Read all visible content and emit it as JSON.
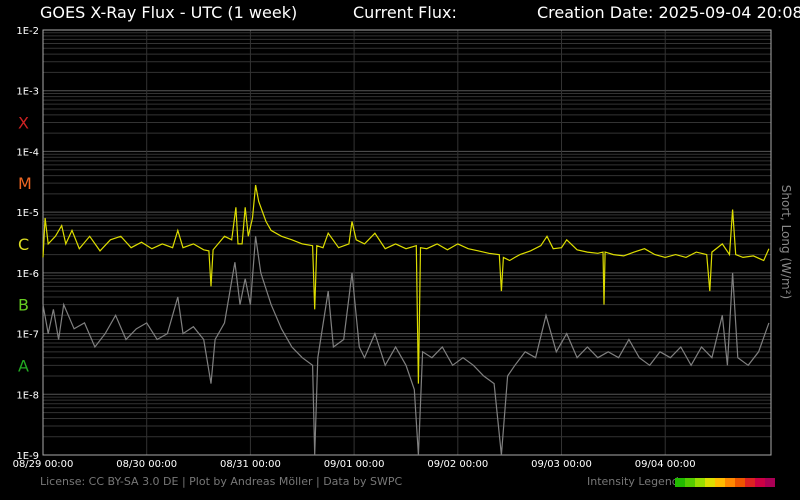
{
  "header": {
    "title": "GOES X-Ray Flux - UTC (1 week)",
    "current_flux_label": "Current Flux:",
    "creation_date": "Creation Date: 2025-09-04 20:08"
  },
  "footer": "License: CC BY-SA 3.0 DE | Plot by Andreas Möller | Data by SWPC",
  "legend": {
    "label": "Intensity Legend",
    "colors": [
      "#22bb00",
      "#55cc00",
      "#99dd00",
      "#dddd00",
      "#ffbb00",
      "#ff8800",
      "#ee5500",
      "#dd2222",
      "#cc0044",
      "#aa0055"
    ]
  },
  "chart_data": {
    "type": "line",
    "ylabel": "Short, Long (W/m²)",
    "y_scale": "log",
    "ylim": [
      1e-09,
      0.01
    ],
    "y_ticks": [
      "1E-9",
      "1E-8",
      "1E-7",
      "1E-6",
      "1E-5",
      "1E-4",
      "1E-3",
      "1E-2"
    ],
    "flare_classes": [
      {
        "label": "X",
        "at": 0.0003,
        "color": "#cc2222"
      },
      {
        "label": "M",
        "at": 3e-05,
        "color": "#ee6622"
      },
      {
        "label": "C",
        "at": 3e-06,
        "color": "#dddd22"
      },
      {
        "label": "B",
        "at": 3e-07,
        "color": "#66cc22"
      },
      {
        "label": "A",
        "at": 3e-08,
        "color": "#22aa22"
      }
    ],
    "x_ticks": [
      "08/29 00:00",
      "08/30 00:00",
      "08/31 00:00",
      "09/01 00:00",
      "09/02 00:00",
      "09/03 00:00",
      "09/04 00:00"
    ],
    "x_range_days": [
      0,
      7.02
    ],
    "grid": true,
    "series": [
      {
        "name": "Long",
        "color": "#dddd00",
        "points": [
          [
            0,
            1.8e-06
          ],
          [
            0.02,
            8e-06
          ],
          [
            0.05,
            3e-06
          ],
          [
            0.12,
            4e-06
          ],
          [
            0.18,
            6e-06
          ],
          [
            0.22,
            3e-06
          ],
          [
            0.28,
            5e-06
          ],
          [
            0.35,
            2.5e-06
          ],
          [
            0.45,
            4e-06
          ],
          [
            0.55,
            2.3e-06
          ],
          [
            0.65,
            3.5e-06
          ],
          [
            0.75,
            4e-06
          ],
          [
            0.85,
            2.6e-06
          ],
          [
            0.95,
            3.2e-06
          ],
          [
            1.05,
            2.5e-06
          ],
          [
            1.15,
            3e-06
          ],
          [
            1.25,
            2.6e-06
          ],
          [
            1.3,
            5e-06
          ],
          [
            1.35,
            2.6e-06
          ],
          [
            1.45,
            3e-06
          ],
          [
            1.55,
            2.4e-06
          ],
          [
            1.6,
            2.3e-06
          ],
          [
            1.62,
            6e-07
          ],
          [
            1.64,
            2.4e-06
          ],
          [
            1.75,
            4e-06
          ],
          [
            1.82,
            3.5e-06
          ],
          [
            1.86,
            1.2e-05
          ],
          [
            1.88,
            3e-06
          ],
          [
            1.92,
            3e-06
          ],
          [
            1.95,
            1.2e-05
          ],
          [
            1.98,
            4e-06
          ],
          [
            2.02,
            8e-06
          ],
          [
            2.05,
            2.8e-05
          ],
          [
            2.08,
            1.5e-05
          ],
          [
            2.15,
            7e-06
          ],
          [
            2.2,
            5e-06
          ],
          [
            2.3,
            4e-06
          ],
          [
            2.4,
            3.5e-06
          ],
          [
            2.5,
            3e-06
          ],
          [
            2.6,
            2.8e-06
          ],
          [
            2.62,
            2.5e-07
          ],
          [
            2.64,
            2.8e-06
          ],
          [
            2.7,
            2.6e-06
          ],
          [
            2.75,
            4.5e-06
          ],
          [
            2.85,
            2.6e-06
          ],
          [
            2.95,
            3e-06
          ],
          [
            2.98,
            7e-06
          ],
          [
            3.02,
            3.5e-06
          ],
          [
            3.1,
            3e-06
          ],
          [
            3.2,
            4.5e-06
          ],
          [
            3.3,
            2.5e-06
          ],
          [
            3.4,
            3e-06
          ],
          [
            3.5,
            2.5e-06
          ],
          [
            3.6,
            2.8e-06
          ],
          [
            3.62,
            1.5e-08
          ],
          [
            3.64,
            2.6e-06
          ],
          [
            3.7,
            2.5e-06
          ],
          [
            3.8,
            3e-06
          ],
          [
            3.9,
            2.4e-06
          ],
          [
            4.0,
            3e-06
          ],
          [
            4.1,
            2.5e-06
          ],
          [
            4.2,
            2.3e-06
          ],
          [
            4.3,
            2.1e-06
          ],
          [
            4.4,
            2e-06
          ],
          [
            4.42,
            5e-07
          ],
          [
            4.44,
            1.8e-06
          ],
          [
            4.5,
            1.6e-06
          ],
          [
            4.55,
            1.8e-06
          ],
          [
            4.6,
            2e-06
          ],
          [
            4.7,
            2.3e-06
          ],
          [
            4.8,
            2.8e-06
          ],
          [
            4.86,
            4e-06
          ],
          [
            4.92,
            2.5e-06
          ],
          [
            5.0,
            2.6e-06
          ],
          [
            5.05,
            3.5e-06
          ],
          [
            5.15,
            2.4e-06
          ],
          [
            5.25,
            2.2e-06
          ],
          [
            5.35,
            2.1e-06
          ],
          [
            5.4,
            2.2e-06
          ],
          [
            5.41,
            3e-07
          ],
          [
            5.42,
            2.2e-06
          ],
          [
            5.5,
            2e-06
          ],
          [
            5.6,
            1.9e-06
          ],
          [
            5.7,
            2.2e-06
          ],
          [
            5.8,
            2.5e-06
          ],
          [
            5.9,
            2e-06
          ],
          [
            6.0,
            1.8e-06
          ],
          [
            6.1,
            2e-06
          ],
          [
            6.2,
            1.8e-06
          ],
          [
            6.3,
            2.2e-06
          ],
          [
            6.4,
            2e-06
          ],
          [
            6.43,
            5e-07
          ],
          [
            6.45,
            2.2e-06
          ],
          [
            6.55,
            3e-06
          ],
          [
            6.62,
            2e-06
          ],
          [
            6.65,
            1.1e-05
          ],
          [
            6.68,
            2e-06
          ],
          [
            6.75,
            1.8e-06
          ],
          [
            6.85,
            1.9e-06
          ],
          [
            6.95,
            1.6e-06
          ],
          [
            7.0,
            2.5e-06
          ]
        ]
      },
      {
        "name": "Short",
        "color": "#808080",
        "points": [
          [
            0,
            3e-07
          ],
          [
            0.05,
            1e-07
          ],
          [
            0.1,
            2.5e-07
          ],
          [
            0.15,
            8e-08
          ],
          [
            0.2,
            3e-07
          ],
          [
            0.3,
            1.2e-07
          ],
          [
            0.4,
            1.5e-07
          ],
          [
            0.5,
            6e-08
          ],
          [
            0.6,
            1e-07
          ],
          [
            0.7,
            2e-07
          ],
          [
            0.8,
            8e-08
          ],
          [
            0.9,
            1.2e-07
          ],
          [
            1.0,
            1.5e-07
          ],
          [
            1.1,
            8e-08
          ],
          [
            1.2,
            1e-07
          ],
          [
            1.3,
            4e-07
          ],
          [
            1.35,
            1e-07
          ],
          [
            1.45,
            1.3e-07
          ],
          [
            1.55,
            8e-08
          ],
          [
            1.62,
            1.5e-08
          ],
          [
            1.66,
            8e-08
          ],
          [
            1.75,
            1.5e-07
          ],
          [
            1.85,
            1.5e-06
          ],
          [
            1.9,
            3e-07
          ],
          [
            1.95,
            8e-07
          ],
          [
            2.0,
            3e-07
          ],
          [
            2.05,
            4e-06
          ],
          [
            2.1,
            1e-06
          ],
          [
            2.2,
            3e-07
          ],
          [
            2.3,
            1.2e-07
          ],
          [
            2.4,
            6e-08
          ],
          [
            2.5,
            4e-08
          ],
          [
            2.6,
            3e-08
          ],
          [
            2.62,
            1e-09
          ],
          [
            2.65,
            4e-08
          ],
          [
            2.75,
            5e-07
          ],
          [
            2.8,
            6e-08
          ],
          [
            2.9,
            8e-08
          ],
          [
            2.98,
            1e-06
          ],
          [
            3.05,
            6e-08
          ],
          [
            3.1,
            4e-08
          ],
          [
            3.2,
            1e-07
          ],
          [
            3.3,
            3e-08
          ],
          [
            3.4,
            6e-08
          ],
          [
            3.5,
            3e-08
          ],
          [
            3.58,
            1.2e-08
          ],
          [
            3.62,
            1e-09
          ],
          [
            3.66,
            5e-08
          ],
          [
            3.75,
            4e-08
          ],
          [
            3.85,
            6e-08
          ],
          [
            3.95,
            3e-08
          ],
          [
            4.05,
            4e-08
          ],
          [
            4.15,
            3e-08
          ],
          [
            4.25,
            2e-08
          ],
          [
            4.35,
            1.5e-08
          ],
          [
            4.42,
            1e-09
          ],
          [
            4.48,
            2e-08
          ],
          [
            4.55,
            3e-08
          ],
          [
            4.65,
            5e-08
          ],
          [
            4.75,
            4e-08
          ],
          [
            4.85,
            2e-07
          ],
          [
            4.95,
            5e-08
          ],
          [
            5.05,
            1e-07
          ],
          [
            5.15,
            4e-08
          ],
          [
            5.25,
            6e-08
          ],
          [
            5.35,
            4e-08
          ],
          [
            5.45,
            5e-08
          ],
          [
            5.55,
            4e-08
          ],
          [
            5.65,
            8e-08
          ],
          [
            5.75,
            4e-08
          ],
          [
            5.85,
            3e-08
          ],
          [
            5.95,
            5e-08
          ],
          [
            6.05,
            4e-08
          ],
          [
            6.15,
            6e-08
          ],
          [
            6.25,
            3e-08
          ],
          [
            6.35,
            6e-08
          ],
          [
            6.45,
            4e-08
          ],
          [
            6.55,
            2e-07
          ],
          [
            6.6,
            3e-08
          ],
          [
            6.65,
            1e-06
          ],
          [
            6.7,
            4e-08
          ],
          [
            6.8,
            3e-08
          ],
          [
            6.9,
            5e-08
          ],
          [
            7.0,
            1.5e-07
          ]
        ]
      }
    ]
  }
}
